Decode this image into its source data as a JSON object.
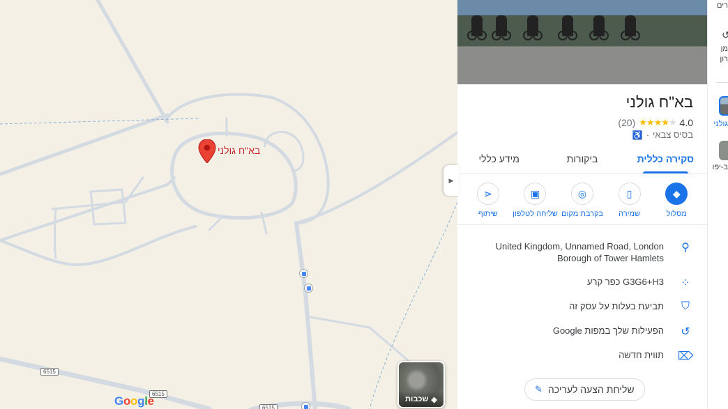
{
  "map": {
    "pin_label": "בא\"ח גולני",
    "route_shields": [
      "6515",
      "6515",
      "6515"
    ],
    "layers_label": "שכבות",
    "google_logo": [
      "G",
      "o",
      "o",
      "g",
      "l",
      "e"
    ]
  },
  "place": {
    "title": "בא\"ח גולני",
    "rating": "4.0",
    "stars_filled": 4,
    "stars_total": 5,
    "review_count": "(20)",
    "category": "בסיס צבאי",
    "separator": "·"
  },
  "tabs": [
    {
      "label": "סקירה כללית",
      "active": true
    },
    {
      "label": "ביקורות",
      "active": false
    },
    {
      "label": "מידע כללי",
      "active": false
    }
  ],
  "actions": [
    {
      "label": "מסלול",
      "icon": "directions-icon"
    },
    {
      "label": "שמירה",
      "icon": "bookmark-icon"
    },
    {
      "label": "בקרבת מקום",
      "icon": "nearby-icon"
    },
    {
      "label": "שליחה לטלפון",
      "icon": "phone-icon"
    },
    {
      "label": "שיתוף",
      "icon": "share-icon"
    }
  ],
  "info": {
    "address": "United Kingdom, Unnamed Road, London Borough of Tower Hamlets",
    "plus_code": "G3G6+H3 כפר קרע",
    "claim": "תביעת בעלות על עסק זה",
    "activity": "הפעילות שלך במפות Google",
    "label": "תווית חדשה"
  },
  "suggest_edit": "שליחת הצעה לעריכה",
  "rail": {
    "top_text": "רים",
    "item_text_1": "מן",
    "item_text_2": "רון",
    "selected_label": "גולני",
    "second_label": "ב-יפו"
  },
  "colors": {
    "accent": "#1a73e8",
    "pin": "#ea4335",
    "map_bg": "#f5f0e6",
    "road": "#d6dde4"
  }
}
